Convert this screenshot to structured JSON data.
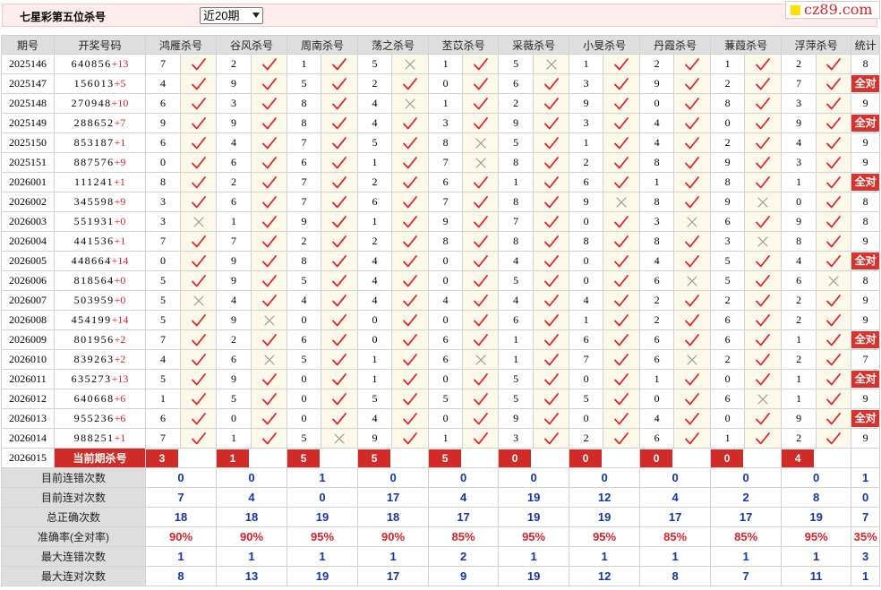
{
  "header": {
    "title": "七星彩第五位杀号",
    "period_select": "近20期",
    "logo": "cz89.com"
  },
  "columns": [
    "期号",
    "开奖号码",
    "鸿雁杀号",
    "谷风杀号",
    "周南杀号",
    "荡之杀号",
    "苤苡杀号",
    "采薇杀号",
    "小旻杀号",
    "丹霞杀号",
    "蒹葭杀号",
    "浮萍杀号",
    "统计"
  ],
  "all_correct_label": "全对",
  "rows": [
    {
      "issue": "2025146",
      "draw": "640856",
      "plus": "+13",
      "kills": [
        [
          7,
          1
        ],
        [
          2,
          1
        ],
        [
          1,
          1
        ],
        [
          5,
          0
        ],
        [
          1,
          1
        ],
        [
          5,
          0
        ],
        [
          1,
          1
        ],
        [
          2,
          1
        ],
        [
          1,
          1
        ],
        [
          2,
          1
        ]
      ],
      "stat": "8"
    },
    {
      "issue": "2025147",
      "draw": "156013",
      "plus": "+5",
      "kills": [
        [
          4,
          1
        ],
        [
          9,
          1
        ],
        [
          5,
          1
        ],
        [
          2,
          1
        ],
        [
          0,
          1
        ],
        [
          6,
          1
        ],
        [
          3,
          1
        ],
        [
          9,
          1
        ],
        [
          2,
          1
        ],
        [
          7,
          1
        ]
      ],
      "stat": "全对"
    },
    {
      "issue": "2025148",
      "draw": "270948",
      "plus": "+10",
      "kills": [
        [
          6,
          1
        ],
        [
          3,
          1
        ],
        [
          8,
          1
        ],
        [
          4,
          0
        ],
        [
          1,
          1
        ],
        [
          2,
          1
        ],
        [
          9,
          1
        ],
        [
          0,
          1
        ],
        [
          8,
          1
        ],
        [
          3,
          1
        ]
      ],
      "stat": "9"
    },
    {
      "issue": "2025149",
      "draw": "288652",
      "plus": "+7",
      "kills": [
        [
          9,
          1
        ],
        [
          9,
          1
        ],
        [
          8,
          1
        ],
        [
          4,
          1
        ],
        [
          3,
          1
        ],
        [
          9,
          1
        ],
        [
          3,
          1
        ],
        [
          4,
          1
        ],
        [
          0,
          1
        ],
        [
          9,
          1
        ]
      ],
      "stat": "全对"
    },
    {
      "issue": "2025150",
      "draw": "853187",
      "plus": "+1",
      "kills": [
        [
          6,
          1
        ],
        [
          4,
          1
        ],
        [
          7,
          1
        ],
        [
          5,
          1
        ],
        [
          8,
          0
        ],
        [
          5,
          1
        ],
        [
          1,
          1
        ],
        [
          4,
          1
        ],
        [
          2,
          1
        ],
        [
          4,
          1
        ]
      ],
      "stat": "9"
    },
    {
      "issue": "2025151",
      "draw": "887576",
      "plus": "+9",
      "kills": [
        [
          0,
          1
        ],
        [
          6,
          1
        ],
        [
          6,
          1
        ],
        [
          1,
          1
        ],
        [
          7,
          0
        ],
        [
          8,
          1
        ],
        [
          2,
          1
        ],
        [
          8,
          1
        ],
        [
          9,
          1
        ],
        [
          3,
          1
        ]
      ],
      "stat": "9"
    },
    {
      "issue": "2026001",
      "draw": "111241",
      "plus": "+1",
      "kills": [
        [
          8,
          1
        ],
        [
          2,
          1
        ],
        [
          7,
          1
        ],
        [
          2,
          1
        ],
        [
          6,
          1
        ],
        [
          1,
          1
        ],
        [
          6,
          1
        ],
        [
          1,
          1
        ],
        [
          8,
          1
        ],
        [
          1,
          1
        ]
      ],
      "stat": "全对"
    },
    {
      "issue": "2026002",
      "draw": "345598",
      "plus": "+9",
      "kills": [
        [
          3,
          1
        ],
        [
          6,
          1
        ],
        [
          7,
          1
        ],
        [
          6,
          1
        ],
        [
          7,
          1
        ],
        [
          8,
          1
        ],
        [
          9,
          0
        ],
        [
          8,
          1
        ],
        [
          9,
          0
        ],
        [
          0,
          1
        ]
      ],
      "stat": "8"
    },
    {
      "issue": "2026003",
      "draw": "551931",
      "plus": "+0",
      "kills": [
        [
          3,
          0
        ],
        [
          1,
          1
        ],
        [
          9,
          1
        ],
        [
          1,
          1
        ],
        [
          9,
          1
        ],
        [
          7,
          1
        ],
        [
          0,
          1
        ],
        [
          3,
          0
        ],
        [
          6,
          1
        ],
        [
          9,
          1
        ]
      ],
      "stat": "8"
    },
    {
      "issue": "2026004",
      "draw": "441536",
      "plus": "+1",
      "kills": [
        [
          7,
          1
        ],
        [
          7,
          1
        ],
        [
          2,
          1
        ],
        [
          2,
          1
        ],
        [
          8,
          1
        ],
        [
          8,
          1
        ],
        [
          8,
          1
        ],
        [
          8,
          1
        ],
        [
          3,
          0
        ],
        [
          8,
          1
        ]
      ],
      "stat": "9"
    },
    {
      "issue": "2026005",
      "draw": "448664",
      "plus": "+14",
      "kills": [
        [
          0,
          1
        ],
        [
          9,
          1
        ],
        [
          8,
          1
        ],
        [
          4,
          1
        ],
        [
          0,
          1
        ],
        [
          4,
          1
        ],
        [
          0,
          1
        ],
        [
          4,
          1
        ],
        [
          5,
          1
        ],
        [
          4,
          1
        ]
      ],
      "stat": "全对"
    },
    {
      "issue": "2026006",
      "draw": "818564",
      "plus": "+0",
      "kills": [
        [
          5,
          1
        ],
        [
          9,
          1
        ],
        [
          5,
          1
        ],
        [
          4,
          1
        ],
        [
          0,
          1
        ],
        [
          5,
          1
        ],
        [
          0,
          1
        ],
        [
          6,
          0
        ],
        [
          5,
          1
        ],
        [
          6,
          0
        ]
      ],
      "stat": "8"
    },
    {
      "issue": "2026007",
      "draw": "503959",
      "plus": "+0",
      "kills": [
        [
          5,
          0
        ],
        [
          4,
          1
        ],
        [
          4,
          1
        ],
        [
          4,
          1
        ],
        [
          4,
          1
        ],
        [
          4,
          1
        ],
        [
          4,
          1
        ],
        [
          2,
          1
        ],
        [
          2,
          1
        ],
        [
          2,
          1
        ]
      ],
      "stat": "9"
    },
    {
      "issue": "2026008",
      "draw": "454199",
      "plus": "+14",
      "kills": [
        [
          5,
          1
        ],
        [
          9,
          0
        ],
        [
          0,
          1
        ],
        [
          0,
          1
        ],
        [
          0,
          1
        ],
        [
          6,
          1
        ],
        [
          1,
          1
        ],
        [
          2,
          1
        ],
        [
          6,
          1
        ],
        [
          2,
          1
        ]
      ],
      "stat": "9"
    },
    {
      "issue": "2026009",
      "draw": "801956",
      "plus": "+2",
      "kills": [
        [
          7,
          1
        ],
        [
          2,
          1
        ],
        [
          6,
          1
        ],
        [
          0,
          1
        ],
        [
          6,
          1
        ],
        [
          1,
          1
        ],
        [
          6,
          1
        ],
        [
          6,
          1
        ],
        [
          6,
          1
        ],
        [
          1,
          1
        ]
      ],
      "stat": "全对"
    },
    {
      "issue": "2026010",
      "draw": "839263",
      "plus": "+2",
      "kills": [
        [
          4,
          1
        ],
        [
          6,
          0
        ],
        [
          5,
          1
        ],
        [
          1,
          1
        ],
        [
          6,
          0
        ],
        [
          1,
          1
        ],
        [
          7,
          1
        ],
        [
          6,
          0
        ],
        [
          2,
          1
        ],
        [
          2,
          1
        ]
      ],
      "stat": "7"
    },
    {
      "issue": "2026011",
      "draw": "635273",
      "plus": "+13",
      "kills": [
        [
          5,
          1
        ],
        [
          9,
          1
        ],
        [
          0,
          1
        ],
        [
          1,
          1
        ],
        [
          0,
          1
        ],
        [
          5,
          1
        ],
        [
          0,
          1
        ],
        [
          1,
          1
        ],
        [
          0,
          1
        ],
        [
          1,
          1
        ]
      ],
      "stat": "全对"
    },
    {
      "issue": "2026012",
      "draw": "640668",
      "plus": "+6",
      "kills": [
        [
          1,
          1
        ],
        [
          5,
          1
        ],
        [
          0,
          1
        ],
        [
          5,
          1
        ],
        [
          5,
          1
        ],
        [
          5,
          1
        ],
        [
          5,
          1
        ],
        [
          0,
          1
        ],
        [
          6,
          0
        ],
        [
          1,
          1
        ]
      ],
      "stat": "9"
    },
    {
      "issue": "2026013",
      "draw": "955236",
      "plus": "+6",
      "kills": [
        [
          6,
          1
        ],
        [
          0,
          1
        ],
        [
          0,
          1
        ],
        [
          4,
          1
        ],
        [
          0,
          1
        ],
        [
          9,
          1
        ],
        [
          0,
          1
        ],
        [
          4,
          1
        ],
        [
          0,
          1
        ],
        [
          9,
          1
        ]
      ],
      "stat": "全对"
    },
    {
      "issue": "2026014",
      "draw": "988251",
      "plus": "+1",
      "kills": [
        [
          7,
          1
        ],
        [
          1,
          1
        ],
        [
          5,
          0
        ],
        [
          9,
          1
        ],
        [
          1,
          1
        ],
        [
          3,
          1
        ],
        [
          2,
          1
        ],
        [
          6,
          1
        ],
        [
          1,
          1
        ],
        [
          2,
          1
        ]
      ],
      "stat": "9"
    }
  ],
  "current": {
    "issue": "2026015",
    "label": "当前期杀号",
    "kills": [
      "3",
      "1",
      "5",
      "5",
      "5",
      "0",
      "0",
      "0",
      "0",
      "4"
    ]
  },
  "summary": [
    {
      "label": "目前连错次数",
      "values": [
        "0",
        "0",
        "1",
        "0",
        "0",
        "0",
        "0",
        "0",
        "0",
        "0",
        "1"
      ],
      "pct": false
    },
    {
      "label": "目前连对次数",
      "values": [
        "7",
        "4",
        "0",
        "17",
        "4",
        "19",
        "12",
        "4",
        "2",
        "8",
        "0"
      ],
      "pct": false
    },
    {
      "label": "总正确次数",
      "values": [
        "18",
        "18",
        "19",
        "18",
        "17",
        "19",
        "19",
        "17",
        "17",
        "19",
        "7"
      ],
      "pct": false
    },
    {
      "label": "准确率(全对率)",
      "values": [
        "90%",
        "90%",
        "95%",
        "90%",
        "85%",
        "95%",
        "95%",
        "85%",
        "85%",
        "95%",
        "35%"
      ],
      "pct": true
    },
    {
      "label": "最大连错次数",
      "values": [
        "1",
        "1",
        "1",
        "1",
        "2",
        "1",
        "1",
        "1",
        "1",
        "1",
        "3"
      ],
      "pct": false
    },
    {
      "label": "最大连对次数",
      "values": [
        "8",
        "13",
        "19",
        "17",
        "9",
        "19",
        "12",
        "8",
        "7",
        "11",
        "1"
      ],
      "pct": false
    }
  ],
  "colors": {
    "check": "#e0232a",
    "cross": "#9a9a9a",
    "accent": "#d12b27",
    "summary_value": "#1535a8"
  }
}
